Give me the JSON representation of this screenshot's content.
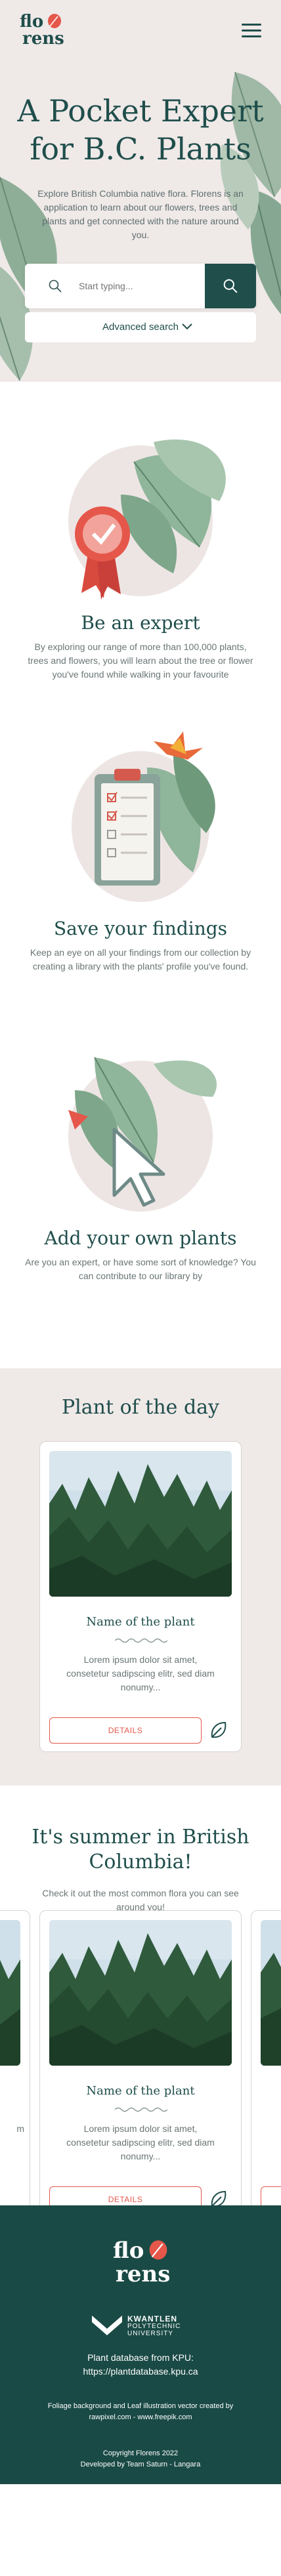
{
  "header": {
    "logo_line1": "flo",
    "logo_line2": "rens"
  },
  "hero": {
    "title": "A Pocket Expert for B.C. Plants",
    "description": "Explore British Columbia native flora. Florens is an application to learn about our flowers, trees and plants and get connected with the nature around you.",
    "search_placeholder": "Start typing...",
    "advanced_search": "Advanced search"
  },
  "features": [
    {
      "title": "Be an expert",
      "description": "By exploring our range of more than 100,000 plants, trees and flowers, you will learn about the tree or flower you've found while walking in your favourite"
    },
    {
      "title": "Save your findings",
      "description": "Keep an eye on all your findings from our collection by creating a library with the plants' profile you've found."
    },
    {
      "title": "Add your own plants",
      "description": "Are you an expert, or have some sort of knowledge? You can contribute to our library by"
    }
  ],
  "plant_of_the_day": {
    "heading": "Plant of the day",
    "card": {
      "name": "Name of the plant",
      "description": "Lorem ipsum dolor sit amet, consetetur sadipscing elitr, sed diam nonumy...",
      "button": "DETAILS"
    }
  },
  "summer": {
    "heading": "It's summer in British Columbia!",
    "description": "Check it out the most common flora you can see around you!",
    "card": {
      "name": "Name of the plant",
      "description": "Lorem ipsum dolor sit amet, consetetur sadipscing elitr, sed diam nonumy...",
      "button": "DETAILS"
    },
    "left_card_partial": "m"
  },
  "footer": {
    "logo_line1": "flo",
    "logo_line2": "rens",
    "kpu_line1": "KWANTLEN",
    "kpu_line2": "POLYTECHNIC",
    "kpu_line3": "UNIVERSITY",
    "database_line1": "Plant database from KPU:",
    "database_line2": "https://plantdatabase.kpu.ca",
    "credit": "Foliage background and Leaf illustration vector created by rawpixel.com - www.freepik.com",
    "copyright_line1": "Copyright Florens 2022",
    "copyright_line2": "Developed by Team Saturn - Langara"
  },
  "colors": {
    "brand_green": "#1f4e4b",
    "accent_red": "#e5574a",
    "hero_bg": "#efe9e8",
    "footer_bg": "#1a4a46"
  }
}
